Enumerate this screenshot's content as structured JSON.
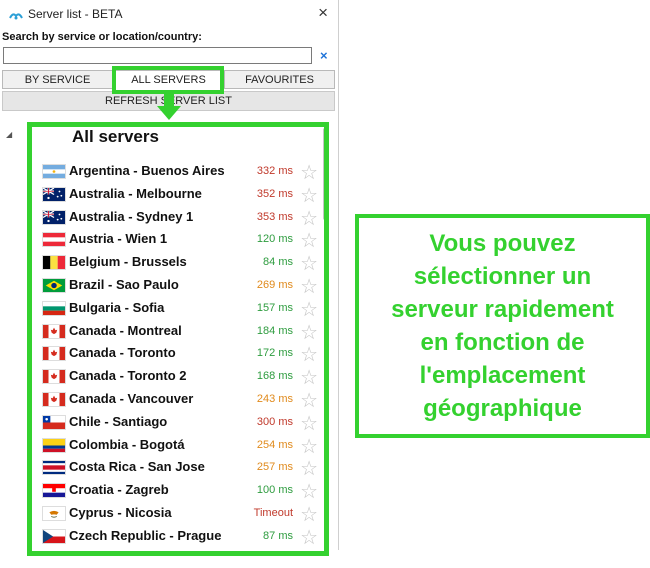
{
  "window": {
    "title": "Server list - BETA",
    "close_label": "×"
  },
  "search": {
    "label": "Search by service or location/country:",
    "value": "",
    "placeholder": "",
    "clear_label": "×"
  },
  "tabs": [
    {
      "label": "BY SERVICE",
      "active": false
    },
    {
      "label": "ALL SERVERS",
      "active": true
    },
    {
      "label": "FAVOURITES",
      "active": false
    }
  ],
  "refresh_label": "REFRESH SERVER LIST",
  "list_heading": "All servers",
  "servers": [
    {
      "name": "Argentina - Buenos Aires",
      "ping": "332 ms",
      "ping_color": "#c0392b",
      "flag": "argentina"
    },
    {
      "name": "Australia - Melbourne",
      "ping": "352 ms",
      "ping_color": "#c0392b",
      "flag": "australia"
    },
    {
      "name": "Australia - Sydney 1",
      "ping": "353 ms",
      "ping_color": "#c0392b",
      "flag": "australia"
    },
    {
      "name": "Austria - Wien 1",
      "ping": "120 ms",
      "ping_color": "#2e9c3f",
      "flag": "austria"
    },
    {
      "name": "Belgium - Brussels",
      "ping": "84 ms",
      "ping_color": "#2e9c3f",
      "flag": "belgium"
    },
    {
      "name": "Brazil - Sao Paulo",
      "ping": "269 ms",
      "ping_color": "#e08a1c",
      "flag": "brazil"
    },
    {
      "name": "Bulgaria - Sofia",
      "ping": "157 ms",
      "ping_color": "#2e9c3f",
      "flag": "bulgaria"
    },
    {
      "name": "Canada - Montreal",
      "ping": "184 ms",
      "ping_color": "#2e9c3f",
      "flag": "canada"
    },
    {
      "name": "Canada - Toronto",
      "ping": "172 ms",
      "ping_color": "#2e9c3f",
      "flag": "canada"
    },
    {
      "name": "Canada - Toronto 2",
      "ping": "168 ms",
      "ping_color": "#2e9c3f",
      "flag": "canada"
    },
    {
      "name": "Canada - Vancouver",
      "ping": "243 ms",
      "ping_color": "#e08a1c",
      "flag": "canada"
    },
    {
      "name": "Chile - Santiago",
      "ping": "300 ms",
      "ping_color": "#c0392b",
      "flag": "chile"
    },
    {
      "name": "Colombia - Bogotá",
      "ping": "254 ms",
      "ping_color": "#e08a1c",
      "flag": "colombia"
    },
    {
      "name": "Costa Rica - San Jose",
      "ping": "257 ms",
      "ping_color": "#e08a1c",
      "flag": "costarica"
    },
    {
      "name": "Croatia - Zagreb",
      "ping": "100 ms",
      "ping_color": "#2e9c3f",
      "flag": "croatia"
    },
    {
      "name": "Cyprus - Nicosia",
      "ping": "Timeout",
      "ping_color": "#c0392b",
      "flag": "cyprus"
    },
    {
      "name": "Czech Republic - Prague",
      "ping": "87 ms",
      "ping_color": "#2e9c3f",
      "flag": "czech"
    }
  ],
  "callout": {
    "lines": [
      "Vous pouvez",
      "sélectionner un",
      "serveur rapidement",
      "en fonction de",
      "l'emplacement",
      "géographique"
    ],
    "color": "#34d12f"
  },
  "colors": {
    "highlight": "#34d12f"
  }
}
